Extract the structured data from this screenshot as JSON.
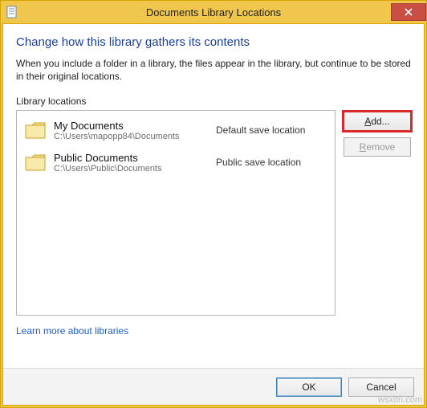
{
  "window": {
    "title": "Documents Library Locations"
  },
  "content": {
    "heading": "Change how this library gathers its contents",
    "description": "When you include a folder in a library, the files appear in the library, but continue to be stored in their original locations.",
    "section_label": "Library locations",
    "learn_more": "Learn more about libraries"
  },
  "buttons": {
    "add": "Add...",
    "remove": "Remove",
    "ok": "OK",
    "cancel": "Cancel"
  },
  "locations": [
    {
      "name": "My Documents",
      "path": "C:\\Users\\mapopp84\\Documents",
      "status": "Default save location"
    },
    {
      "name": "Public Documents",
      "path": "C:\\Users\\Public\\Documents",
      "status": "Public save location"
    }
  ],
  "watermark": "wsxdn.com"
}
